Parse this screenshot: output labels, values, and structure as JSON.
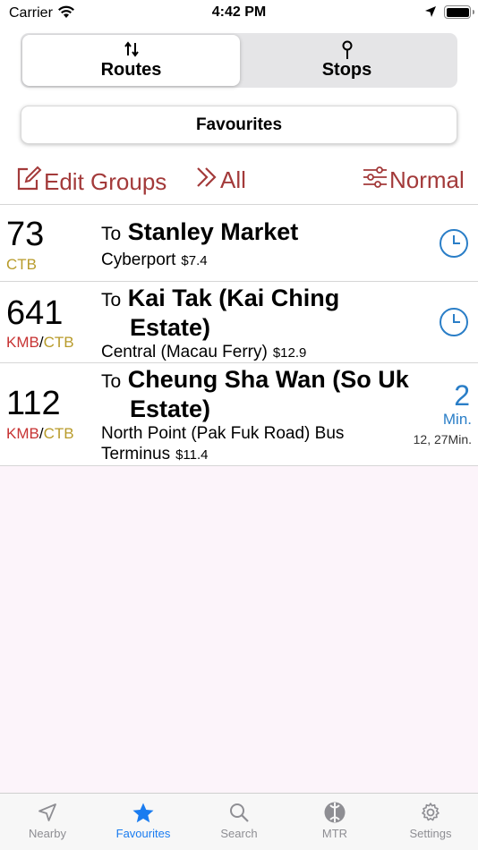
{
  "status_bar": {
    "carrier": "Carrier",
    "time": "4:42 PM"
  },
  "segment": {
    "routes_label": "Routes",
    "stops_label": "Stops",
    "selected": "Routes"
  },
  "group_button": {
    "label": "Favourites"
  },
  "toolbar": {
    "edit_label": "Edit Groups",
    "all_label": "All",
    "normal_label": "Normal",
    "color": "#a33a3a"
  },
  "routes": [
    {
      "number": "73",
      "companies": [
        "CTB"
      ],
      "to_prefix": "To",
      "destination": "Stanley Market",
      "origin": "Cyberport",
      "fare": "$7.4",
      "eta": {
        "type": "clock-icon"
      }
    },
    {
      "number": "641",
      "companies": [
        "KMB",
        "CTB"
      ],
      "to_prefix": "To",
      "destination": "Kai Tak (Kai Ching Estate)",
      "origin": "Central (Macau Ferry)",
      "fare": "$12.9",
      "eta": {
        "type": "clock-icon"
      }
    },
    {
      "number": "112",
      "companies": [
        "KMB",
        "CTB"
      ],
      "to_prefix": "To",
      "destination": "Cheung Sha Wan (So Uk Estate)",
      "origin": "North Point (Pak Fuk Road) Bus Terminus",
      "fare": "$11.4",
      "eta": {
        "type": "minutes",
        "value": "2",
        "unit": "Min.",
        "next": "12, 27Min."
      }
    }
  ],
  "colors": {
    "kmb": "#c73333",
    "ctb": "#b89b2a",
    "eta": "#2a7ec7",
    "tab_active": "#1a7cf0",
    "background": "#fcf4fa"
  },
  "tab_bar": {
    "items": [
      {
        "label": "Nearby",
        "icon": "location-arrow-icon"
      },
      {
        "label": "Favourites",
        "icon": "star-icon"
      },
      {
        "label": "Search",
        "icon": "search-icon"
      },
      {
        "label": "MTR",
        "icon": "mtr-logo-icon"
      },
      {
        "label": "Settings",
        "icon": "gear-icon"
      }
    ],
    "selected": "Favourites"
  }
}
